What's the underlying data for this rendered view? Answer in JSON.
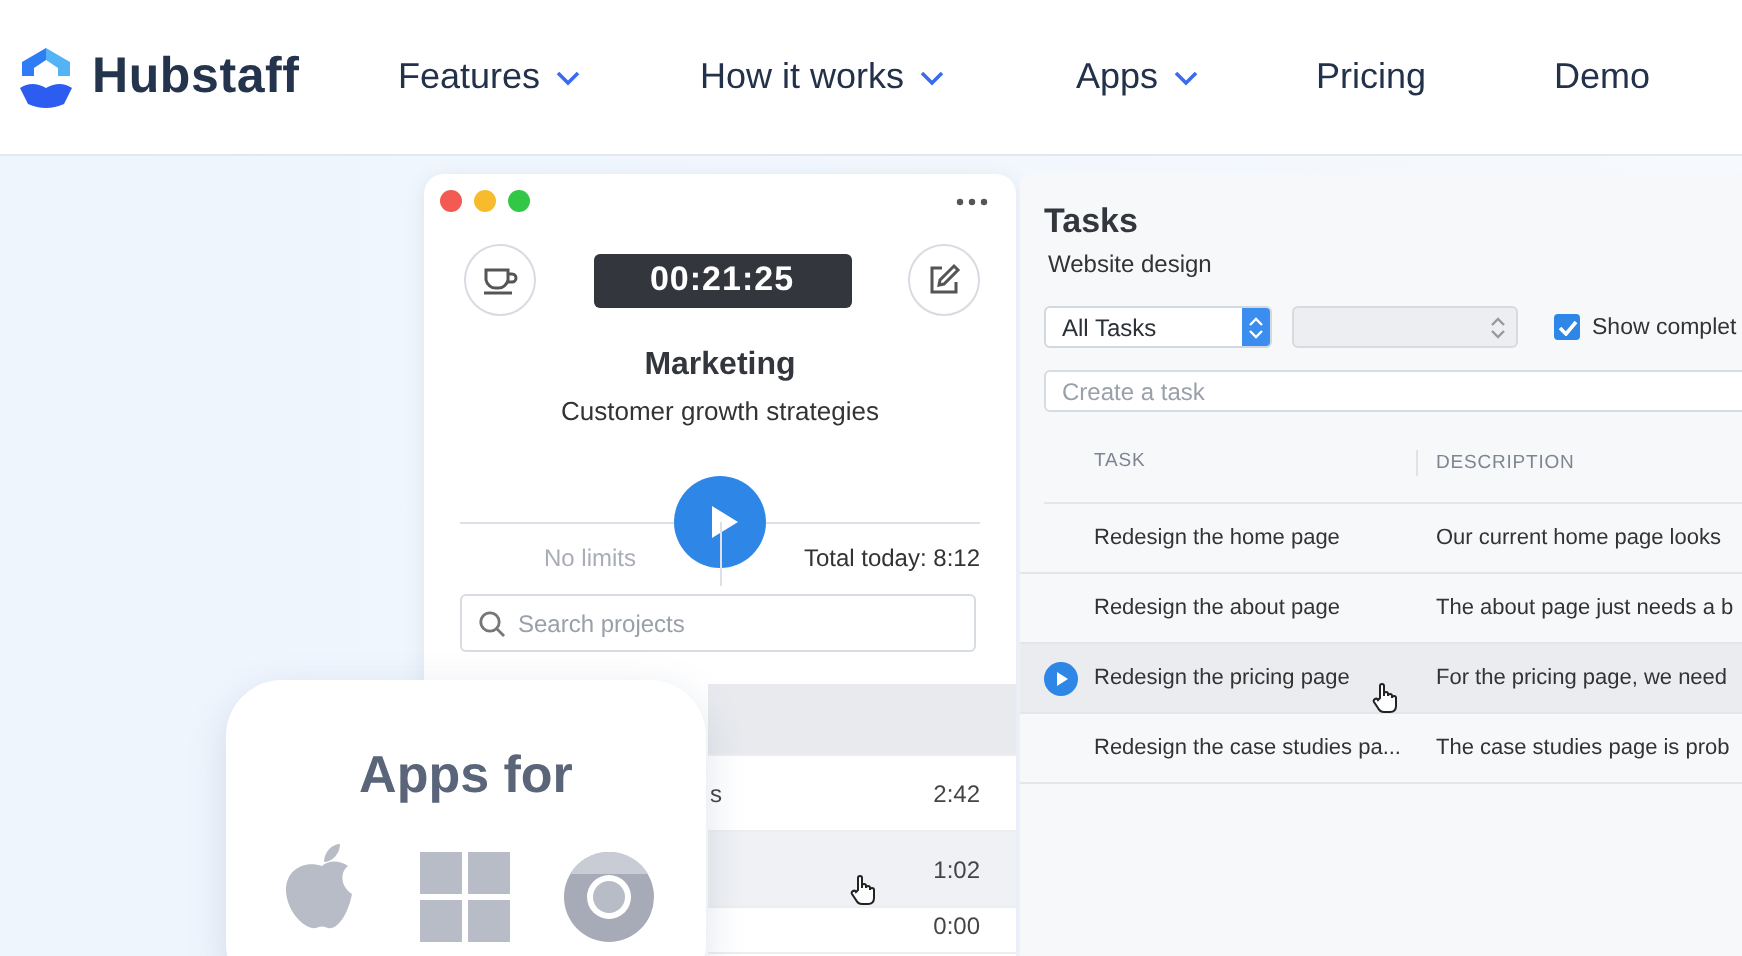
{
  "header": {
    "brand": "Hubstaff",
    "nav": [
      {
        "label": "Features",
        "dropdown": true
      },
      {
        "label": "How it works",
        "dropdown": true
      },
      {
        "label": "Apps",
        "dropdown": true
      },
      {
        "label": "Pricing",
        "dropdown": false
      },
      {
        "label": "Demo",
        "dropdown": false
      }
    ]
  },
  "timer_app": {
    "timer": "00:21:25",
    "project": "Marketing",
    "task": "Customer growth strategies",
    "limit": "No limits",
    "total": "Total today: 8:12",
    "search": {
      "placeholder": "Search projects"
    },
    "projects": [
      {
        "selected": false,
        "kind": "group"
      },
      {
        "name": "s",
        "time": "2:42",
        "selected": false,
        "kind": "project"
      },
      {
        "time": "1:02",
        "selected": true,
        "kind": "project"
      },
      {
        "time": "0:00",
        "selected": false,
        "kind": "project"
      }
    ]
  },
  "tasks_panel": {
    "title": "Tasks",
    "subtitle": "Website design",
    "filter": "All Tasks",
    "show_completed": {
      "label": "Show complet",
      "checked": true
    },
    "create": {
      "placeholder": "Create a task"
    },
    "columns": [
      "TASK",
      "DESCRIPTION"
    ],
    "rows": [
      {
        "task": "Redesign the home page",
        "description": "Our current home page looks",
        "selected": false
      },
      {
        "task": "Redesign the about page",
        "description": "The about page just needs a b",
        "selected": false
      },
      {
        "task": "Redesign the pricing page",
        "description": "For the pricing page, we need",
        "selected": true
      },
      {
        "task": "Redesign the case studies pa...",
        "description": "The case studies page is prob",
        "selected": false
      }
    ]
  },
  "apps_card": {
    "title": "Apps for"
  }
}
